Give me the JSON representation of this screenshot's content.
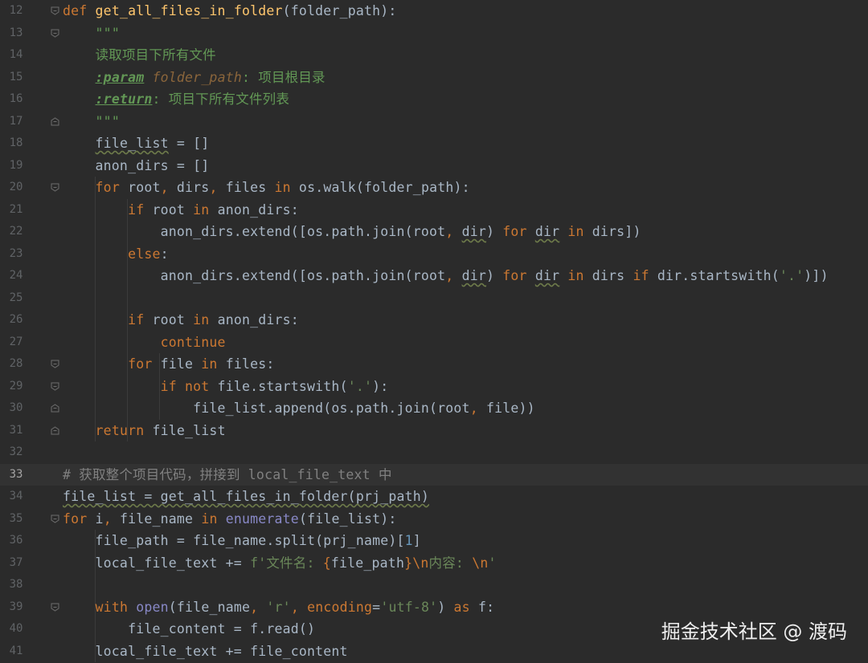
{
  "editor": {
    "current_line": "33",
    "lines": [
      {
        "n": "12",
        "fold": "open",
        "tokens": [
          {
            "t": "def",
            "c": "kw"
          },
          {
            "t": " "
          },
          {
            "t": "get_all_files_in_folder",
            "c": "fn"
          },
          {
            "t": "(folder_path):"
          }
        ]
      },
      {
        "n": "13",
        "fold": "open",
        "tokens": [
          {
            "t": "    "
          },
          {
            "t": "\"\"\"",
            "c": "doc"
          }
        ]
      },
      {
        "n": "14",
        "tokens": [
          {
            "t": "    "
          },
          {
            "t": "读取项目下所有文件",
            "c": "doc"
          }
        ]
      },
      {
        "n": "15",
        "tokens": [
          {
            "t": "    "
          },
          {
            "t": ":param",
            "c": "doctag"
          },
          {
            "t": " "
          },
          {
            "t": "folder_path",
            "c": "docparam"
          },
          {
            "t": ": 项目根目录",
            "c": "doc"
          }
        ]
      },
      {
        "n": "16",
        "tokens": [
          {
            "t": "    "
          },
          {
            "t": ":return",
            "c": "doctag"
          },
          {
            "t": ": 项目下所有文件列表",
            "c": "doc"
          }
        ]
      },
      {
        "n": "17",
        "fold": "close",
        "tokens": [
          {
            "t": "    "
          },
          {
            "t": "\"\"\"",
            "c": "doc"
          }
        ]
      },
      {
        "n": "18",
        "tokens": [
          {
            "t": "    "
          },
          {
            "t": "file_list",
            "c": "wavy"
          },
          {
            "t": " = []"
          }
        ]
      },
      {
        "n": "19",
        "tokens": [
          {
            "t": "    anon_dirs = []"
          }
        ]
      },
      {
        "n": "20",
        "fold": "open",
        "tokens": [
          {
            "t": "    "
          },
          {
            "t": "for",
            "c": "kw"
          },
          {
            "t": " root"
          },
          {
            "t": ",",
            "c": "kw"
          },
          {
            "t": " dirs"
          },
          {
            "t": ",",
            "c": "kw"
          },
          {
            "t": " files "
          },
          {
            "t": "in",
            "c": "kw"
          },
          {
            "t": " os.walk(folder_path):"
          }
        ]
      },
      {
        "n": "21",
        "tokens": [
          {
            "t": "        "
          },
          {
            "t": "if",
            "c": "kw"
          },
          {
            "t": " root "
          },
          {
            "t": "in",
            "c": "kw"
          },
          {
            "t": " anon_dirs:"
          }
        ]
      },
      {
        "n": "22",
        "tokens": [
          {
            "t": "            anon_dirs.extend([os.path.join(root"
          },
          {
            "t": ",",
            "c": "kw"
          },
          {
            "t": " "
          },
          {
            "t": "dir",
            "c": "wavy"
          },
          {
            "t": ") "
          },
          {
            "t": "for",
            "c": "kw"
          },
          {
            "t": " "
          },
          {
            "t": "dir",
            "c": "wavy"
          },
          {
            "t": " "
          },
          {
            "t": "in",
            "c": "kw"
          },
          {
            "t": " dirs])"
          }
        ]
      },
      {
        "n": "23",
        "tokens": [
          {
            "t": "        "
          },
          {
            "t": "else",
            "c": "kw"
          },
          {
            "t": ":"
          }
        ]
      },
      {
        "n": "24",
        "tokens": [
          {
            "t": "            anon_dirs.extend([os.path.join(root"
          },
          {
            "t": ",",
            "c": "kw"
          },
          {
            "t": " "
          },
          {
            "t": "dir",
            "c": "wavy"
          },
          {
            "t": ") "
          },
          {
            "t": "for",
            "c": "kw"
          },
          {
            "t": " "
          },
          {
            "t": "dir",
            "c": "wavy"
          },
          {
            "t": " "
          },
          {
            "t": "in",
            "c": "kw"
          },
          {
            "t": " dirs "
          },
          {
            "t": "if",
            "c": "kw"
          },
          {
            "t": " dir.startswith("
          },
          {
            "t": "'.'",
            "c": "str"
          },
          {
            "t": ")])"
          }
        ]
      },
      {
        "n": "25",
        "tokens": []
      },
      {
        "n": "26",
        "tokens": [
          {
            "t": "        "
          },
          {
            "t": "if",
            "c": "kw"
          },
          {
            "t": " root "
          },
          {
            "t": "in",
            "c": "kw"
          },
          {
            "t": " anon_dirs:"
          }
        ]
      },
      {
        "n": "27",
        "tokens": [
          {
            "t": "            "
          },
          {
            "t": "continue",
            "c": "kw"
          }
        ]
      },
      {
        "n": "28",
        "fold": "open",
        "tokens": [
          {
            "t": "        "
          },
          {
            "t": "for",
            "c": "kw"
          },
          {
            "t": " file "
          },
          {
            "t": "in",
            "c": "kw"
          },
          {
            "t": " files:"
          }
        ]
      },
      {
        "n": "29",
        "fold": "open",
        "tokens": [
          {
            "t": "            "
          },
          {
            "t": "if not",
            "c": "kw"
          },
          {
            "t": " file.startswith("
          },
          {
            "t": "'.'",
            "c": "str"
          },
          {
            "t": "):"
          }
        ]
      },
      {
        "n": "30",
        "fold": "close",
        "tokens": [
          {
            "t": "                file_list.append(os.path.join(root"
          },
          {
            "t": ",",
            "c": "kw"
          },
          {
            "t": " file))"
          }
        ]
      },
      {
        "n": "31",
        "fold": "close",
        "tokens": [
          {
            "t": "    "
          },
          {
            "t": "return",
            "c": "kw"
          },
          {
            "t": " file_list"
          }
        ]
      },
      {
        "n": "32",
        "tokens": []
      },
      {
        "n": "33",
        "tokens": [
          {
            "t": "# 获取整个项目代码，拼接到 local_file_text 中",
            "c": "comment"
          }
        ]
      },
      {
        "n": "34",
        "tokens": [
          {
            "t": "file_list = get_all_files_in_folder(prj_path)",
            "c": "wavy"
          }
        ]
      },
      {
        "n": "35",
        "fold": "open",
        "tokens": [
          {
            "t": "for",
            "c": "kw"
          },
          {
            "t": " i"
          },
          {
            "t": ",",
            "c": "kw"
          },
          {
            "t": " file_name "
          },
          {
            "t": "in",
            "c": "kw"
          },
          {
            "t": " "
          },
          {
            "t": "enumerate",
            "c": "builtin"
          },
          {
            "t": "(file_list):"
          }
        ]
      },
      {
        "n": "36",
        "tokens": [
          {
            "t": "    file_path = file_name.split(prj_name)["
          },
          {
            "t": "1",
            "c": "num"
          },
          {
            "t": "]"
          }
        ]
      },
      {
        "n": "37",
        "tokens": [
          {
            "t": "    local_file_text += "
          },
          {
            "t": "f'文件名: ",
            "c": "str"
          },
          {
            "t": "{",
            "c": "brace"
          },
          {
            "t": "file_path"
          },
          {
            "t": "}",
            "c": "brace"
          },
          {
            "t": "\\n",
            "c": "esc"
          },
          {
            "t": "内容: ",
            "c": "str"
          },
          {
            "t": "\\n",
            "c": "esc"
          },
          {
            "t": "'",
            "c": "str"
          }
        ]
      },
      {
        "n": "38",
        "tokens": []
      },
      {
        "n": "39",
        "fold": "open",
        "tokens": [
          {
            "t": "    "
          },
          {
            "t": "with",
            "c": "kw"
          },
          {
            "t": " "
          },
          {
            "t": "open",
            "c": "builtin"
          },
          {
            "t": "(file_name"
          },
          {
            "t": ",",
            "c": "kw"
          },
          {
            "t": " "
          },
          {
            "t": "'r'",
            "c": "str"
          },
          {
            "t": ", ",
            "c": "kw"
          },
          {
            "t": "encoding",
            "c": "kw"
          },
          {
            "t": "="
          },
          {
            "t": "'utf-8'",
            "c": "str"
          },
          {
            "t": ") "
          },
          {
            "t": "as",
            "c": "kw"
          },
          {
            "t": " f:"
          }
        ]
      },
      {
        "n": "40",
        "tokens": [
          {
            "t": "        file_content = f.read()"
          }
        ]
      },
      {
        "n": "41",
        "tokens": [
          {
            "t": "    local_file_text += file_content"
          }
        ]
      }
    ]
  },
  "watermark": "掘金技术社区 @ 渡码",
  "colors": {
    "background": "#2b2b2b",
    "keyword": "#cc7832",
    "function": "#ffc66d",
    "string": "#6a8759",
    "docstring": "#629755",
    "comment": "#808080",
    "default": "#a9b7c6"
  }
}
